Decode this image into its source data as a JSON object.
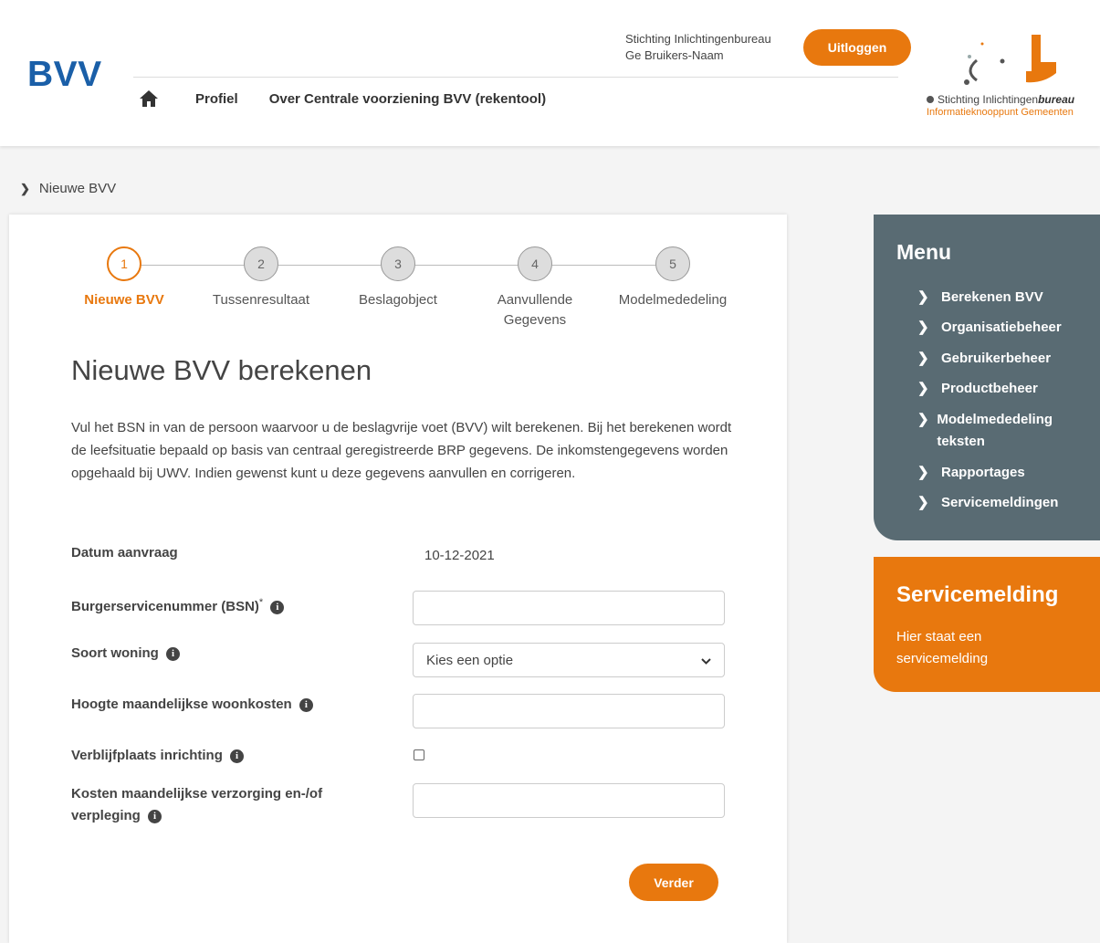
{
  "header": {
    "app_title": "BVV",
    "org_name": "Stichting Inlichtingenbureau",
    "user_name": "Ge Bruikers-Naam",
    "logout_label": "Uitloggen",
    "nav": [
      "Profiel",
      "Over Centrale voorziening BVV (rekentool)"
    ],
    "brand_name_1": "Stichting Inlichtingen",
    "brand_name_2": "bureau",
    "brand_sub": "Informatieknooppunt Gemeenten"
  },
  "breadcrumb": "Nieuwe BVV",
  "steps": [
    {
      "number": "1",
      "label": "Nieuwe BVV",
      "active": true
    },
    {
      "number": "2",
      "label": "Tussenresultaat"
    },
    {
      "number": "3",
      "label": "Beslagobject"
    },
    {
      "number": "4",
      "label": "Aanvullende Gegevens"
    },
    {
      "number": "5",
      "label": "Modelmededeling"
    }
  ],
  "form": {
    "title": "Nieuwe BVV berekenen",
    "intro": "Vul het BSN in van de persoon waarvoor u de beslagvrije voet (BVV) wilt berekenen. Bij het berekenen wordt de leefsituatie bepaald op basis van centraal geregistreerde BRP gegevens. De inkomstengegevens worden opgehaald bij UWV. Indien gewenst kunt u deze gegevens aanvullen en corrigeren.",
    "date_label": "Datum aanvraag",
    "date_value": "10-12-2021",
    "bsn_label": "Burgerservicenummer (BSN)",
    "bsn_required": "*",
    "bsn_value": "",
    "woning_label": "Soort woning",
    "woning_selected": "Kies een optie",
    "woonkosten_label": "Hoogte maandelijkse woonkosten",
    "woonkosten_value": "",
    "inrichting_label": "Verblijfplaats inrichting",
    "verzorging_label_1": "Kosten maandelijkse verzorging en-/of",
    "verzorging_label_2": "verpleging",
    "verzorging_value": "",
    "submit_label": "Verder"
  },
  "menu": {
    "title": "Menu",
    "items": [
      "Berekenen BVV",
      "Organisatiebeheer",
      "Gebruikerbeheer",
      "Productbeheer",
      "Modelmededeling teksten",
      "Rapportages",
      "Servicemeldingen"
    ]
  },
  "service": {
    "title": "Servicemelding",
    "text": "Hier staat een servicemelding"
  },
  "colors": {
    "accent": "#e8780e",
    "brand_blue": "#1a5fa8",
    "menu_bg": "#596b73"
  }
}
